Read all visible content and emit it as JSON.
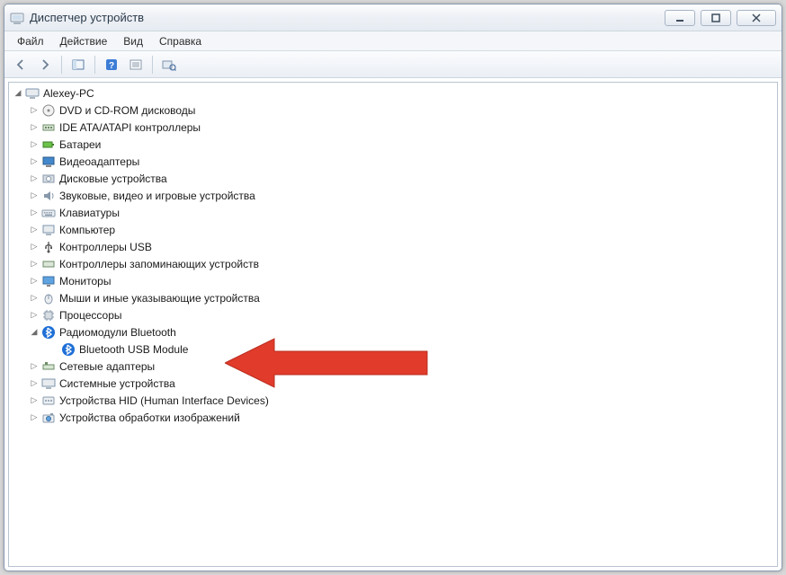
{
  "window": {
    "title": "Диспетчер устройств"
  },
  "menu": {
    "file": "Файл",
    "action": "Действие",
    "view": "Вид",
    "help": "Справка"
  },
  "tree": {
    "root": "Alexey-PC",
    "items": [
      {
        "label": "DVD и CD-ROM дисководы"
      },
      {
        "label": "IDE ATA/ATAPI контроллеры"
      },
      {
        "label": "Батареи"
      },
      {
        "label": "Видеоадаптеры"
      },
      {
        "label": "Дисковые устройства"
      },
      {
        "label": "Звуковые, видео и игровые устройства"
      },
      {
        "label": "Клавиатуры"
      },
      {
        "label": "Компьютер"
      },
      {
        "label": "Контроллеры USB"
      },
      {
        "label": "Контроллеры запоминающих устройств"
      },
      {
        "label": "Мониторы"
      },
      {
        "label": "Мыши и иные указывающие устройства"
      },
      {
        "label": "Процессоры"
      },
      {
        "label": "Радиомодули Bluetooth"
      },
      {
        "label": "Bluetooth USB Module"
      },
      {
        "label": "Сетевые адаптеры"
      },
      {
        "label": "Системные устройства"
      },
      {
        "label": "Устройства HID (Human Interface Devices)"
      },
      {
        "label": "Устройства обработки изображений"
      }
    ]
  }
}
